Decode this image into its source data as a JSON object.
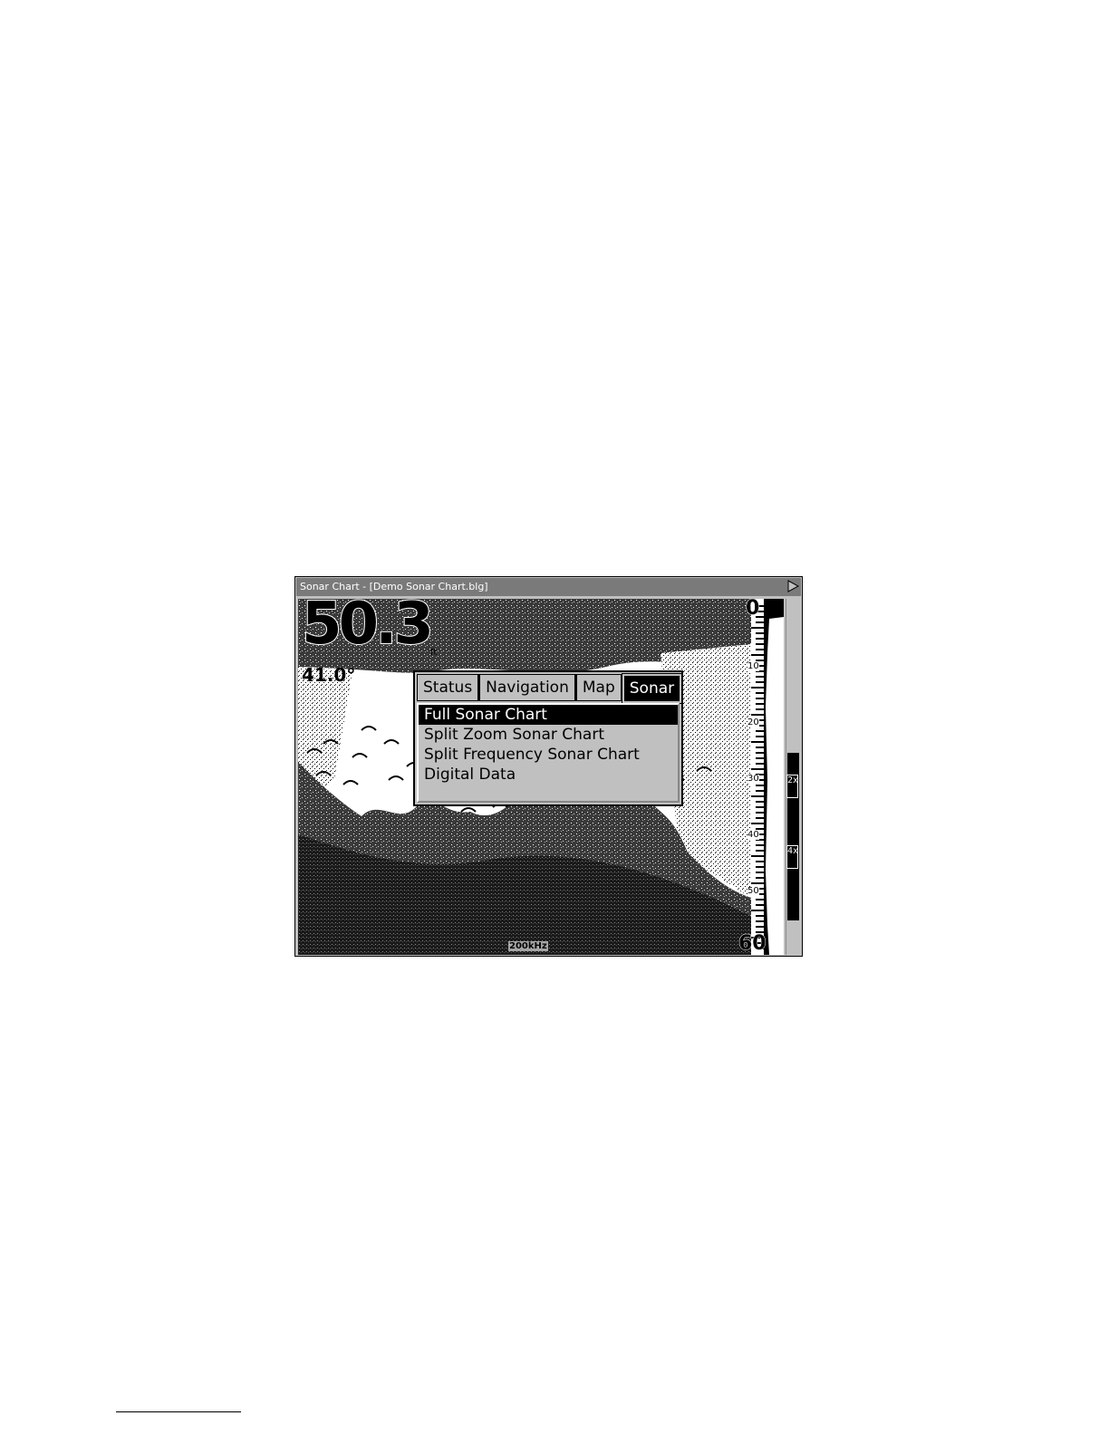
{
  "window": {
    "title": "Sonar Chart - [Demo Sonar Chart.blg]",
    "expand_icon": "triangle-right-icon"
  },
  "sonar": {
    "depth": "50.3",
    "depth_unit": "ft",
    "temperature": "41.0°",
    "frequency": "200kHz",
    "range_top": "0",
    "range_bottom": "60",
    "scale_marks": [
      "10",
      "20",
      "30",
      "40",
      "50"
    ]
  },
  "zoom": {
    "levels": [
      "2x",
      "4x"
    ]
  },
  "menu": {
    "tabs": [
      {
        "label": "Status",
        "active": false
      },
      {
        "label": "Navigation",
        "active": false
      },
      {
        "label": "Map",
        "active": false
      },
      {
        "label": "Sonar",
        "active": true
      }
    ],
    "items": [
      {
        "label": "Full Sonar Chart",
        "selected": true
      },
      {
        "label": "Split Zoom Sonar Chart",
        "selected": false
      },
      {
        "label": "Split Frequency Sonar Chart",
        "selected": false
      },
      {
        "label": "Digital Data",
        "selected": false
      }
    ]
  }
}
